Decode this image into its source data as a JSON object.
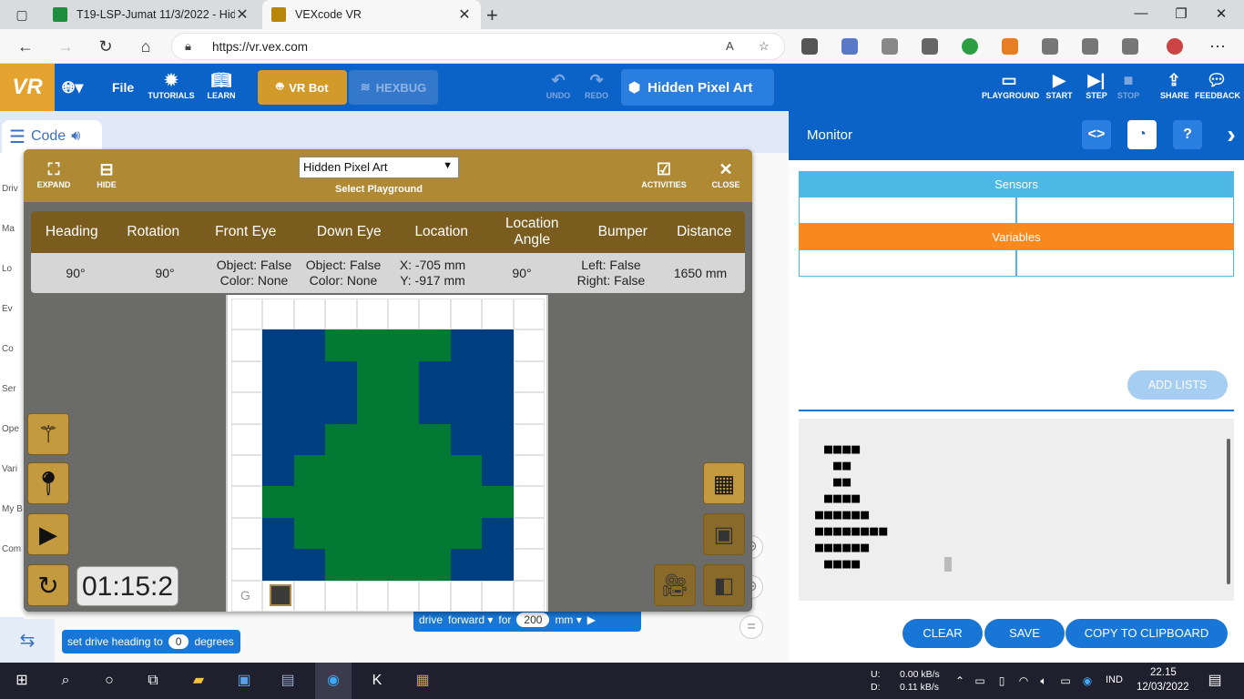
{
  "browser": {
    "tabs": [
      {
        "title": "T19-LSP-Jumat 11/3/2022 - Hidd",
        "favicon_color": "#1e8e3e"
      },
      {
        "title": "VEXcode VR",
        "favicon_color": "#b8860b"
      }
    ],
    "url": "https://vr.vex.com"
  },
  "header": {
    "logo": "VR",
    "file": "File",
    "tutorials": "TUTORIALS",
    "learn": "LEARN",
    "vr_bot": "VR Bot",
    "hexbug": "HEXBUG",
    "undo": "UNDO",
    "redo": "REDO",
    "project_name": "Hidden Pixel Art",
    "playground": "PLAYGROUND",
    "start": "START",
    "step": "STEP",
    "stop": "STOP",
    "share": "SHARE",
    "feedback": "FEEDBACK"
  },
  "code_tab": "Code",
  "palette": [
    "Driv",
    "Ma",
    "Lo",
    "Ev",
    "Co",
    "Ser",
    "Ope",
    "Vari",
    "My B",
    "Com"
  ],
  "blocks": {
    "heading_text": "set drive heading to",
    "heading_value": "0",
    "heading_unit": "degrees",
    "drive": "drive",
    "direction": "forward ▾",
    "for": "for",
    "distance": "200",
    "unit": "mm ▾"
  },
  "playground": {
    "expand": "EXPAND",
    "hide": "HIDE",
    "select_value": "Hidden Pixel Art",
    "select_label": "Select Playground",
    "activities": "ACTIVITIES",
    "close": "CLOSE",
    "stats_headers": [
      "Heading",
      "Rotation",
      "Front Eye",
      "Down Eye",
      "Location",
      "Location Angle",
      "Bumper",
      "Distance"
    ],
    "stats_values": [
      [
        "90°"
      ],
      [
        "90°"
      ],
      [
        "Object: False",
        "Color: None"
      ],
      [
        "Object: False",
        "Color: None"
      ],
      [
        "X: -705 mm",
        "Y: -917 mm"
      ],
      [
        "90°"
      ],
      [
        "Left: False",
        "Right: False"
      ],
      [
        "1650 mm"
      ]
    ],
    "grid_label": "G",
    "timer": "01:15:2",
    "pixel_colors": {
      "blue": "#003f7f",
      "green": "#007a33"
    },
    "pixel_rows": [
      "WWWWWWWWWW",
      "WBBGGGGBBW",
      "WBBBGGBBBW",
      "WBBBGGBBBW",
      "WBBGGGGBBW",
      "WBGGGGGGBW",
      "WGGGGGGGGW",
      "WBGGGGGGBW",
      "WBBGGGGBBW",
      "WWWWWWWWWW"
    ]
  },
  "monitor": {
    "title": "Monitor",
    "sensors": "Sensors",
    "variables": "Variables",
    "add_lists": "ADD LISTS",
    "print_lines": [
      " ■■■■",
      "  ■■",
      "  ■■",
      " ■■■■",
      "■■■■■■",
      "■■■■■■■■",
      "■■■■■■",
      " ■■■■"
    ],
    "clear": "CLEAR",
    "save": "SAVE",
    "copy": "COPY TO CLIPBOARD"
  },
  "taskbar": {
    "upload_label": "U:",
    "download_label": "D:",
    "upload": "0.00 kB/s",
    "download": "0.11 kB/s",
    "lang": "IND",
    "time": "22.15",
    "date": "12/03/2022"
  }
}
